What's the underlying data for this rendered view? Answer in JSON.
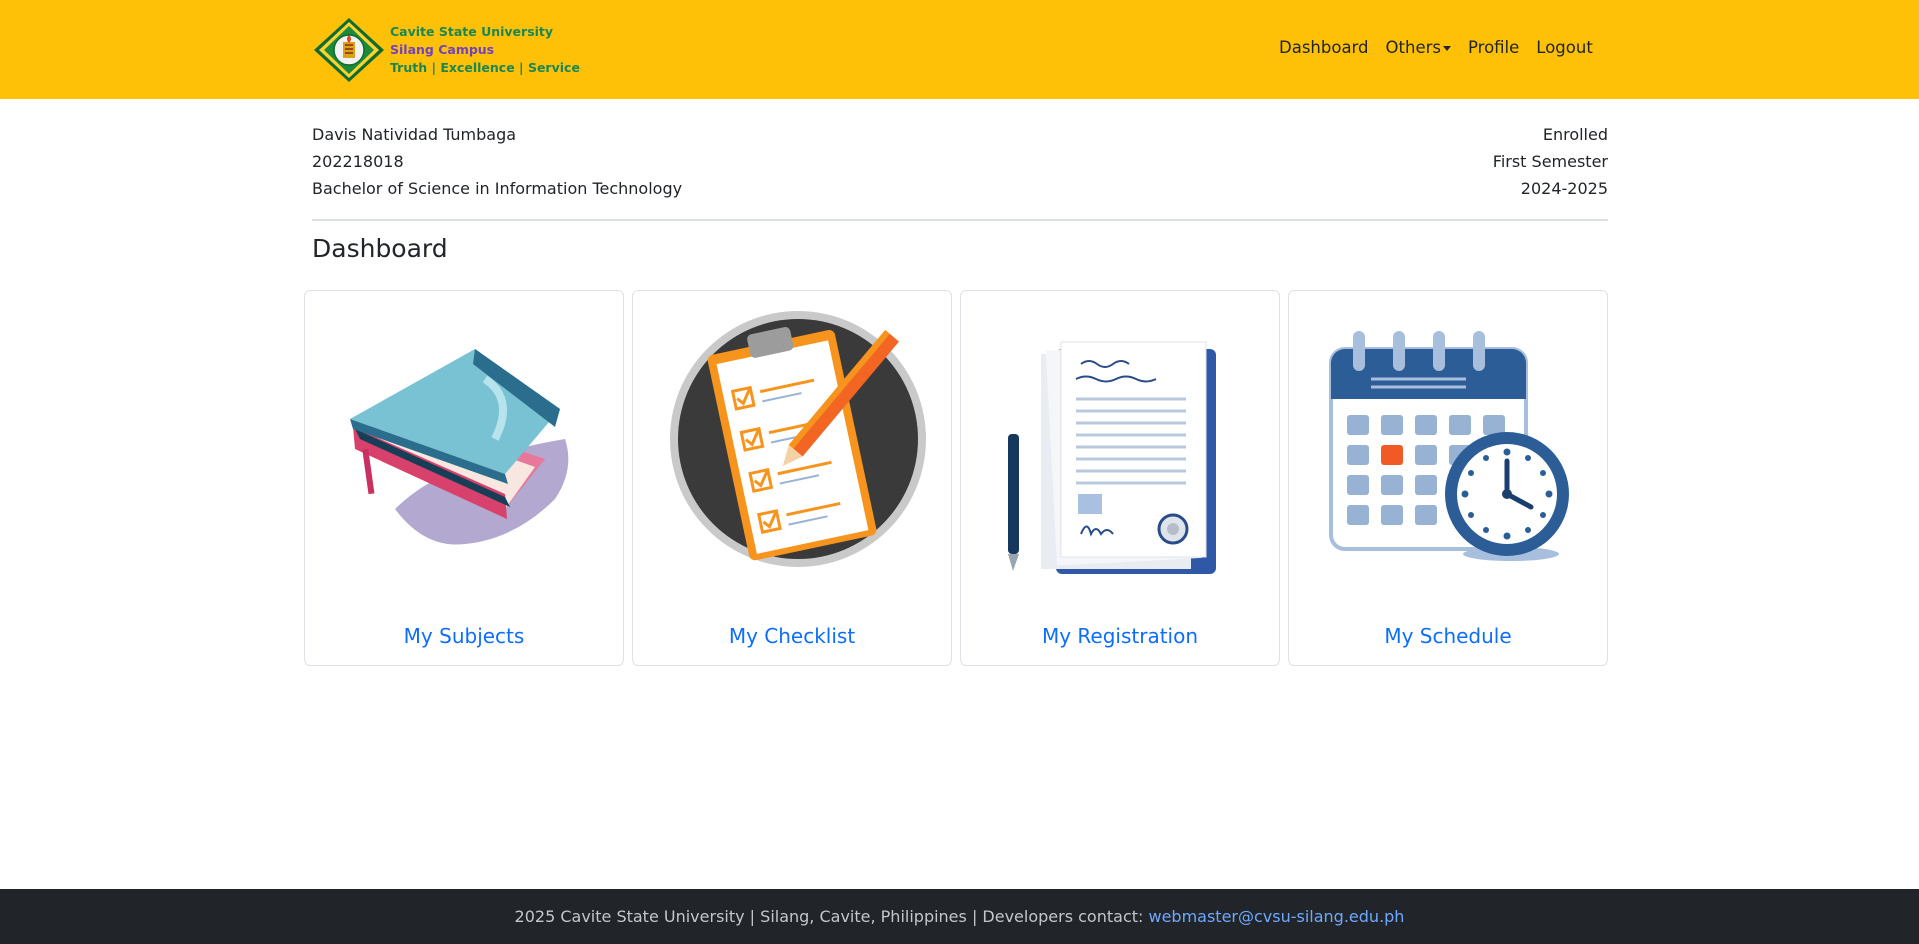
{
  "header": {
    "brand": {
      "line1": "Cavite State University",
      "line2": "Silang Campus",
      "line3": "Truth | Excellence | Service"
    },
    "nav": {
      "dashboard": "Dashboard",
      "others": "Others",
      "profile": "Profile",
      "logout": "Logout"
    }
  },
  "student": {
    "name": "Davis Natividad Tumbaga",
    "id": "202218018",
    "program": "Bachelor of Science in Information Technology",
    "status": "Enrolled",
    "semester": "First Semester",
    "school_year": "2024-2025"
  },
  "main": {
    "title": "Dashboard",
    "cards": [
      {
        "label": "My Subjects",
        "icon": "book-stack-icon"
      },
      {
        "label": "My Checklist",
        "icon": "clipboard-checklist-icon"
      },
      {
        "label": "My Registration",
        "icon": "registration-documents-icon"
      },
      {
        "label": "My Schedule",
        "icon": "calendar-clock-icon"
      }
    ]
  },
  "footer": {
    "text": "2025 Cavite State University | Silang, Cavite, Philippines | Developers contact: ",
    "email": "webmaster@cvsu-silang.edu.ph"
  },
  "colors": {
    "header_bg": "#ffc107",
    "link_blue": "#0d6efd",
    "footer_bg": "#212529",
    "brand_green": "#198754",
    "brand_purple": "#6f42c1"
  }
}
